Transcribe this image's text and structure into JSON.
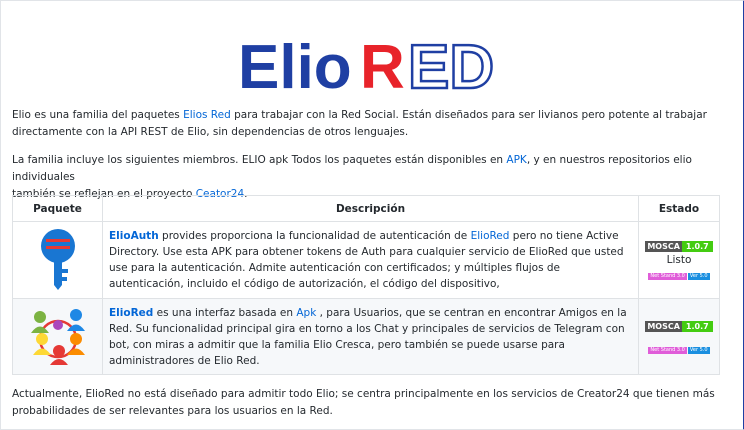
{
  "logo": {
    "part1": "Elio",
    "part2": "RED"
  },
  "intro": {
    "text1": "Elio es una familia del paquetes ",
    "link1": "Elios Red",
    "text2": " para trabajar con la Red Social. Están diseñados para ser livianos pero potente al trabajar",
    "text3": "directamente con la API REST de Elio, sin dependencias de otros lenguajes."
  },
  "family": {
    "text1": "La familia incluye los siguientes miembros. ELIO apk Todos los paquetes están disponibles en ",
    "link1": "APK",
    "text2": ", y en nuestros repositorios elio individuales",
    "text3": "también se reflejan en el proyecto ",
    "link2": "Ceator24",
    "text4": "."
  },
  "table": {
    "headers": [
      "Paquete",
      "Descripción",
      "Estado"
    ],
    "rows": [
      {
        "name": "ElioAuth",
        "desc1": " provides proporciona la funcionalidad de autenticación de ",
        "link": "ElioRed",
        "desc2": " pero no tiene Active Directory. Use esta APK para obtener tokens de Auth para cualquier servicio de ElioRed que usted use para la autenticación. Admite autenticación con certificados; y múltiples flujos de autenticación, incluido el código de autorización, el código del dispositivo,",
        "badge_left": "MOSCA",
        "badge_right": "1.0.7",
        "status": "Listo",
        "mini_left": "Net Stand 3.0",
        "mini_right": "Ver 5.0"
      },
      {
        "name": "ElioRed",
        "desc1": " es una interfaz basada en ",
        "link": "Apk",
        "desc2": " , para Usuarios, que se centran en encontrar Amigos en la Red. Su funcionalidad principal gira en torno a los Chat y principales de servicios de Telegram con bot, con miras a admitir que la familia Elio Cresca, pero también se puede usarse para administradores de Elio Red.",
        "badge_left": "MOSCA",
        "badge_right": "1.0.7",
        "status": "",
        "mini_left": "Net Stand 3.0",
        "mini_right": "Ver 5.0"
      }
    ]
  },
  "footer": {
    "line1": "Actualmente, ElioRed no está diseñado para admitir todo Elio; se centra principalmente en los servicios de Creator24 que tienen más",
    "line2": "probabilidades de ser relevantes para los usuarios en la Red."
  },
  "colors": {
    "logo_blue": "#1f3fa3",
    "logo_red": "#e8232a",
    "link": "#0366d6",
    "badge_green": "#44cc11"
  }
}
